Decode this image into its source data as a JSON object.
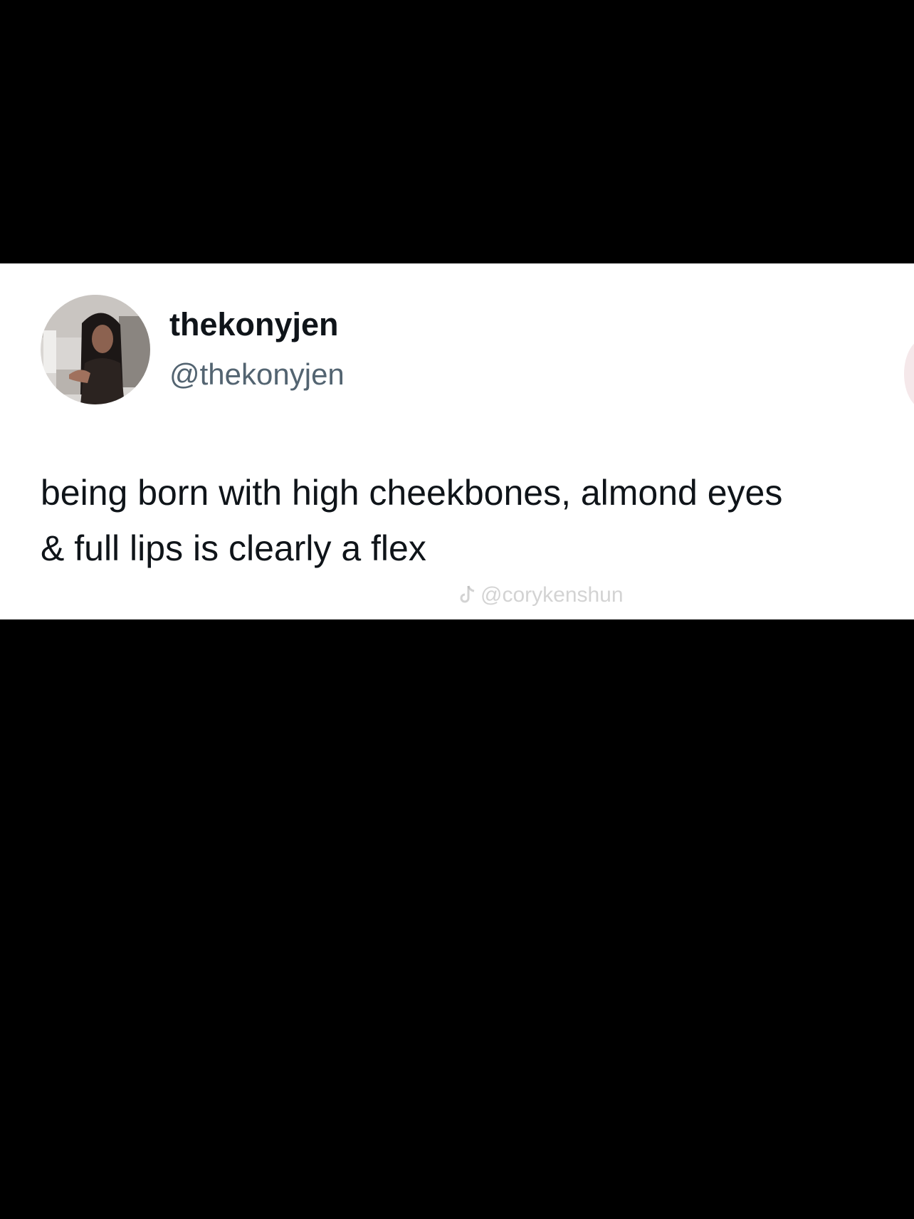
{
  "post": {
    "author": {
      "display_name": "thekonyjen",
      "handle": "@thekonyjen",
      "avatar_icon": "profile-photo"
    },
    "text_lines": [
      "being born with high cheekbones, almond eyes",
      "& full lips is clearly a flex"
    ]
  },
  "watermark": {
    "icon": "tiktok-icon",
    "text": "@corykenshun"
  },
  "colors": {
    "background": "#000000",
    "card": "#ffffff",
    "name": "#0f1419",
    "handle": "#536471"
  }
}
